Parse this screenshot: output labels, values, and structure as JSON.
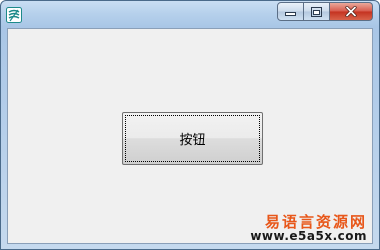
{
  "window": {
    "icon": "app-logo-icon",
    "controls": {
      "minimize_icon": "minimize-icon",
      "maximize_icon": "maximize-icon",
      "close_icon": "close-icon"
    }
  },
  "form": {
    "button_label": "按钮"
  },
  "watermark": {
    "title": "易语言资源网",
    "url": "www.e5a5x.com",
    "title_color": "#e8571a"
  }
}
